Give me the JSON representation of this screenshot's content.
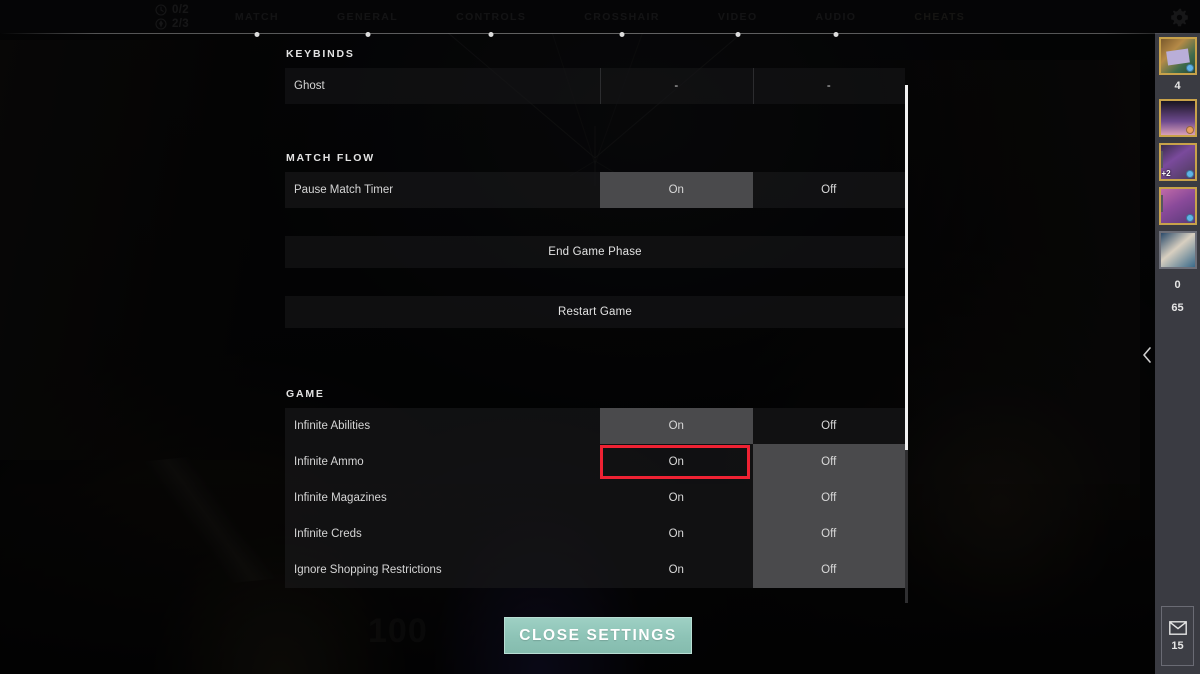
{
  "topbar": {
    "counters": [
      {
        "icon": "clock-icon",
        "value": "0/2"
      },
      {
        "icon": "spike-icon",
        "value": "2/3"
      }
    ],
    "nav": [
      {
        "label": "MATCH",
        "active": false
      },
      {
        "label": "GENERAL",
        "active": false
      },
      {
        "label": "CONTROLS",
        "active": false
      },
      {
        "label": "CROSSHAIR",
        "active": false
      },
      {
        "label": "VIDEO",
        "active": false
      },
      {
        "label": "AUDIO",
        "active": false
      },
      {
        "label": "CHEATS",
        "active": true
      }
    ],
    "gear_icon": "gear-icon",
    "active_color": "#d8d3ab"
  },
  "settings": {
    "sections": [
      {
        "title": "KEYBINDS",
        "rows": [
          {
            "label": "Ghost",
            "type": "keybind",
            "values": [
              "-",
              "-"
            ]
          }
        ]
      },
      {
        "title": "MATCH FLOW",
        "rows": [
          {
            "label": "Pause Match Timer",
            "type": "toggle",
            "options": [
              "On",
              "Off"
            ],
            "selected": "On"
          }
        ],
        "buttons": [
          {
            "label": "End Game Phase"
          },
          {
            "label": "Restart Game"
          }
        ]
      },
      {
        "title": "GAME",
        "rows": [
          {
            "label": "Infinite Abilities",
            "type": "toggle",
            "options": [
              "On",
              "Off"
            ],
            "selected": "On",
            "highlighted": true
          },
          {
            "label": "Infinite Ammo",
            "type": "toggle",
            "options": [
              "On",
              "Off"
            ],
            "selected": "Off"
          },
          {
            "label": "Infinite Magazines",
            "type": "toggle",
            "options": [
              "On",
              "Off"
            ],
            "selected": "Off"
          },
          {
            "label": "Infinite Creds",
            "type": "toggle",
            "options": [
              "On",
              "Off"
            ],
            "selected": "Off"
          },
          {
            "label": "Ignore Shopping Restrictions",
            "type": "toggle",
            "options": [
              "On",
              "Off"
            ],
            "selected": "Off"
          }
        ]
      }
    ],
    "highlight_color": "#ef2233",
    "scrollbar": {
      "thumb_fraction": "70%"
    }
  },
  "close_button": {
    "label": "CLOSE SETTINGS",
    "color": "#8dc3b6"
  },
  "sidebar": {
    "cards": [
      {
        "name": "card-1",
        "badge": "",
        "dot": "blue"
      },
      {
        "name": "card-2",
        "badge": "",
        "dot": "orange"
      },
      {
        "name": "card-3",
        "badge": "+2",
        "dot": "blue"
      },
      {
        "name": "card-4",
        "badge": "",
        "dot": "blue"
      },
      {
        "name": "card-5",
        "badge": "",
        "dot": ""
      }
    ],
    "numbers": [
      "4",
      "0",
      "65"
    ],
    "mail": {
      "icon": "mail-icon",
      "count": "15"
    },
    "collapse_icon": "chevron-left-icon"
  },
  "hud": {
    "health": "100",
    "shield": ""
  }
}
